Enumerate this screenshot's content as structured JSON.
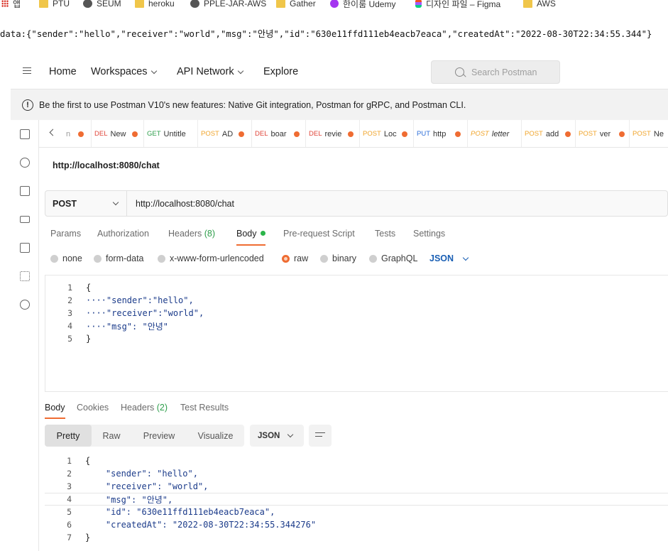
{
  "bookmarks": [
    {
      "icon": "apps-icon",
      "label": "앱"
    },
    {
      "icon": "folder-icon",
      "label": "PTU"
    },
    {
      "icon": "globe-icon",
      "label": "SEUM"
    },
    {
      "icon": "folder-icon",
      "label": "heroku"
    },
    {
      "icon": "globe-icon",
      "label": "PPLE-JAR-AWS"
    },
    {
      "icon": "folder-icon",
      "label": "Gather"
    },
    {
      "icon": "udemy-icon",
      "label": "한이룸 Udemy"
    },
    {
      "icon": "figma-icon",
      "label": "디자인 파일 – Figma"
    },
    {
      "icon": "folder-icon",
      "label": "AWS"
    }
  ],
  "raw_output": "data:{\"sender\":\"hello\",\"receiver\":\"world\",\"msg\":\"안녕\",\"id\":\"630e11ffd111eb4eacb7eaca\",\"createdAt\":\"2022-08-30T22:34:55.344\"}",
  "nav": {
    "home": "Home",
    "workspaces": "Workspaces",
    "api_network": "API Network",
    "explore": "Explore",
    "search_placeholder": "Search Postman"
  },
  "banner": {
    "text": "Be the first to use Postman V10's new features: Native Git integration, Postman for gRPC, and Postman CLI."
  },
  "tabs": [
    {
      "method": "",
      "name": "n"
    },
    {
      "method": "DEL",
      "name": "New"
    },
    {
      "method": "GET",
      "name": "Untitle"
    },
    {
      "method": "POST",
      "name": "AD"
    },
    {
      "method": "DEL",
      "name": "boar"
    },
    {
      "method": "DEL",
      "name": "revie"
    },
    {
      "method": "POST",
      "name": "Loc"
    },
    {
      "method": "PUT",
      "name": "http"
    },
    {
      "method": "POST",
      "name": "letter"
    },
    {
      "method": "POST",
      "name": "add"
    },
    {
      "method": "POST",
      "name": "ver"
    },
    {
      "method": "POST",
      "name": "Ne"
    }
  ],
  "request": {
    "name": "http://localhost:8080/chat",
    "method": "POST",
    "url": "http://localhost:8080/chat"
  },
  "request_tabs": {
    "params": "Params",
    "authorization": "Authorization",
    "headers": "Headers",
    "headers_count": "(8)",
    "body": "Body",
    "prerequest": "Pre-request Script",
    "tests": "Tests",
    "settings": "Settings"
  },
  "body_options": {
    "none": "none",
    "form_data": "form-data",
    "urlencoded": "x-www-form-urlencoded",
    "raw": "raw",
    "binary": "binary",
    "graphql": "GraphQL",
    "format": "JSON"
  },
  "request_body": [
    {
      "n": "1",
      "text": "{"
    },
    {
      "n": "2",
      "text": "····\"sender\":\"hello\","
    },
    {
      "n": "3",
      "text": "····\"receiver\":\"world\","
    },
    {
      "n": "4",
      "text": "····\"msg\": \"안녕\""
    },
    {
      "n": "5",
      "text": "}"
    }
  ],
  "response_tabs": {
    "body": "Body",
    "cookies": "Cookies",
    "headers": "Headers",
    "headers_count": "(2)",
    "test_results": "Test Results"
  },
  "response_tools": {
    "pretty": "Pretty",
    "raw": "Raw",
    "preview": "Preview",
    "visualize": "Visualize",
    "format": "JSON"
  },
  "response_body": [
    {
      "n": "1",
      "text": "{"
    },
    {
      "n": "2",
      "text": "    \"sender\": \"hello\","
    },
    {
      "n": "3",
      "text": "    \"receiver\": \"world\","
    },
    {
      "n": "4",
      "text": "    \"msg\": \"안녕\","
    },
    {
      "n": "5",
      "text": "    \"id\": \"630e11ffd111eb4eacb7eaca\","
    },
    {
      "n": "6",
      "text": "    \"createdAt\": \"2022-08-30T22:34:55.344276\""
    },
    {
      "n": "7",
      "text": "}"
    }
  ],
  "colors": {
    "accent": "#ef6c32",
    "json_link": "#1a5fb4",
    "body_dot": "#2bb54a"
  }
}
